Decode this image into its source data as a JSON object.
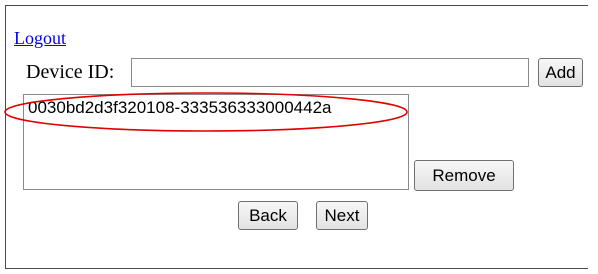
{
  "header": {
    "logout_label": "Logout"
  },
  "device": {
    "label": "Device ID:",
    "input_value": "",
    "add_label": "Add"
  },
  "device_list": {
    "items": [
      "0030bd2d3f320108-333536333000442a"
    ],
    "remove_label": "Remove"
  },
  "nav": {
    "back_label": "Back",
    "next_label": "Next"
  },
  "colors": {
    "link": "#0000ee",
    "annotation": "#e00000"
  }
}
